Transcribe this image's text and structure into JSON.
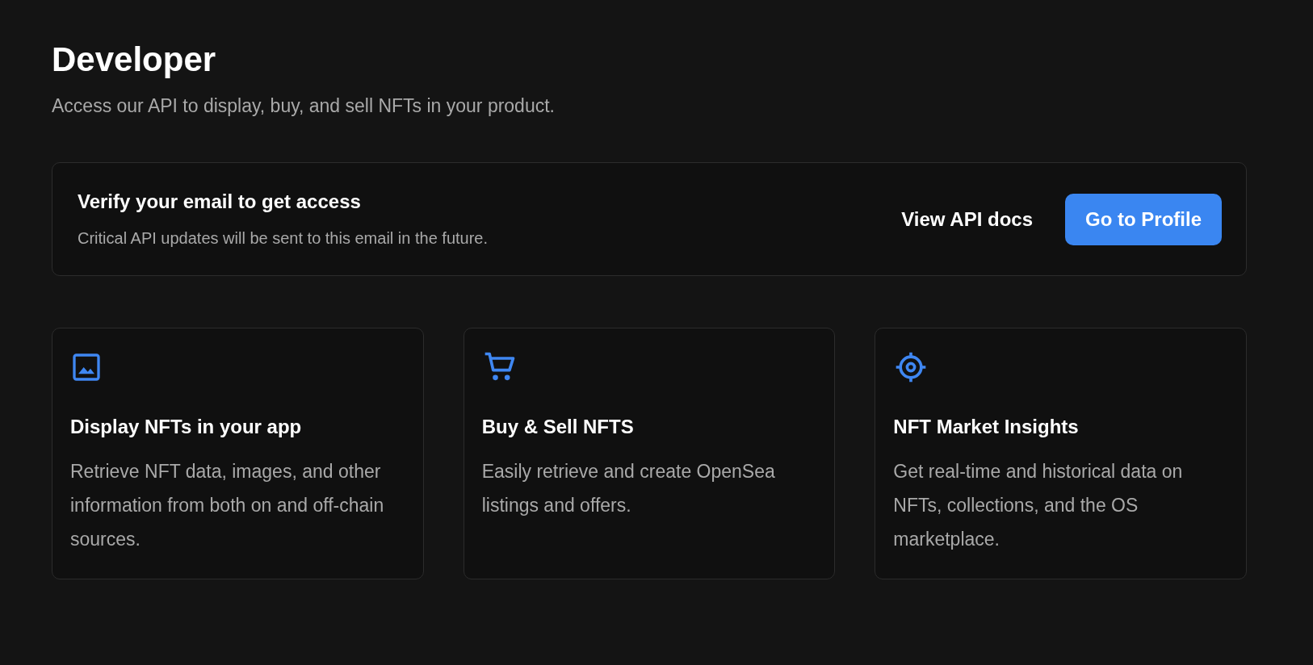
{
  "header": {
    "title": "Developer",
    "subtitle": "Access our API to display, buy, and sell NFTs in your product."
  },
  "banner": {
    "title": "Verify your email to get access",
    "text": "Critical API updates will be sent to this email in the future.",
    "link": "View API docs",
    "button": "Go to Profile"
  },
  "cards": [
    {
      "title": "Display NFTs in your app",
      "text": "Retrieve NFT data, images, and other information from both on and off-chain sources."
    },
    {
      "title": "Buy & Sell NFTS",
      "text": "Easily retrieve and create OpenSea listings and offers."
    },
    {
      "title": "NFT Market Insights",
      "text": "Get real-time and historical data on NFTs, collections, and the OS marketplace."
    }
  ]
}
